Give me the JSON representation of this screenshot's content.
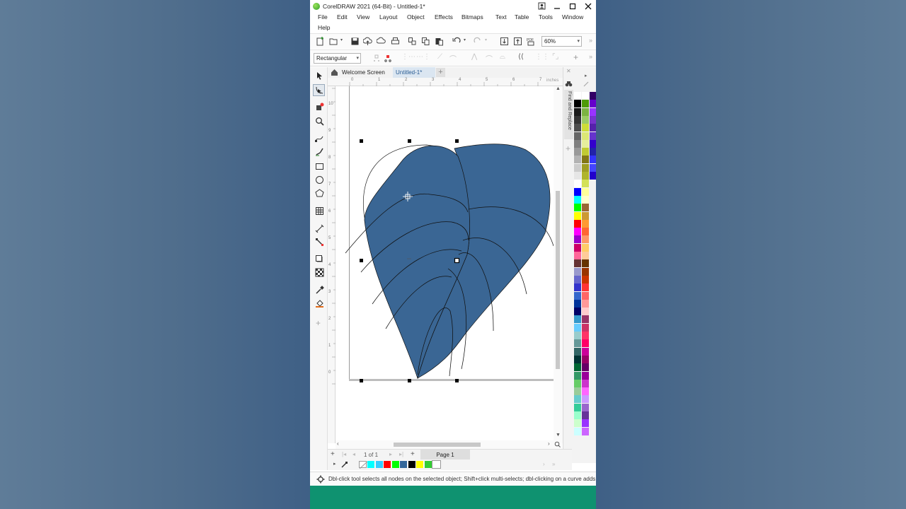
{
  "window": {
    "title": "CorelDRAW 2021 (64-Bit) - Untitled-1*",
    "menu": [
      "File",
      "Edit",
      "View",
      "Layout",
      "Object",
      "Effects",
      "Bitmaps",
      "Text",
      "Table",
      "Tools",
      "Window",
      "Help"
    ]
  },
  "toolbar": {
    "zoom_value": "60%"
  },
  "property_bar": {
    "mode_value": "Rectangular"
  },
  "tabs": {
    "welcome": "Welcome Screen",
    "doc": "Untitled-1*"
  },
  "ruler": {
    "unit": "inches",
    "h_ticks": [
      "0",
      "1",
      "2",
      "3",
      "4",
      "5",
      "6",
      "7"
    ],
    "v_ticks": [
      "10",
      "9",
      "8",
      "7",
      "6",
      "5",
      "4",
      "3",
      "2",
      "1",
      "0"
    ]
  },
  "docker": {
    "label": "Find and Replace"
  },
  "page_nav": {
    "counter": "1 of 1",
    "page_tab": "Page 1"
  },
  "status": {
    "text": "Dbl-click tool selects all nodes on the selected object; Shift+click multi-selects; dbl-clicking on a curve adds"
  },
  "colors": {
    "leaf_fill": "#3a6694",
    "accent_green": "#0f9270",
    "palette_col1": [
      "#ffffff",
      "#000000",
      "#1a1a1a",
      "#333333",
      "#4d4d4d",
      "#666666",
      "#808080",
      "#999999",
      "#b3b3b3",
      "#cccccc",
      "#e6e6e6",
      "#ffffff",
      "#0000ff",
      "#00ffff",
      "#00ff00",
      "#ffff00",
      "#ff0000",
      "#ff00ff",
      "#9900cc",
      "#cc0066",
      "#ff6699",
      "#663333",
      "#9999cc",
      "#6666cc",
      "#3333cc",
      "#3366cc",
      "#003399",
      "#000066",
      "#3399cc",
      "#66ccff",
      "#99cccc",
      "#669999",
      "#336666",
      "#003333",
      "#006633",
      "#339966",
      "#66cc66",
      "#99cc99",
      "#66cccc",
      "#33cc99",
      "#99ffcc",
      "#ccffcc",
      "#ccffff"
    ],
    "palette_col2": [
      "#ffffff",
      "#4e9a06",
      "#7cb342",
      "#9ccc65",
      "#cddc39",
      "#dce775",
      "#e6ee9c",
      "#c0ca33",
      "#827717",
      "#9e9d24",
      "#afb42b",
      "#d4e157",
      "#ffff99",
      "#ffffcc",
      "#996633",
      "#cc9933",
      "#ff9933",
      "#ff6633",
      "#ff9966",
      "#ffcc66",
      "#ffcc99",
      "#663300",
      "#993300",
      "#cc3300",
      "#ff3333",
      "#ff6666",
      "#ff9999",
      "#ffcccc",
      "#993366",
      "#cc3366",
      "#ff3366",
      "#ff0066",
      "#cc0099",
      "#990066",
      "#660066",
      "#990099",
      "#cc33cc",
      "#ff66ff",
      "#cc99ff",
      "#9966cc",
      "#663399",
      "#9933ff",
      "#cc66ff"
    ],
    "palette_col3": [
      "#330066",
      "#6600cc",
      "#9933ff",
      "#7733cc",
      "#5522aa",
      "#6633cc",
      "#3300cc",
      "#2222aa",
      "#3333ff",
      "#4444ff",
      "#2200cc"
    ],
    "doc_palette": [
      "#00ffff",
      "#33ccff",
      "#ff0000",
      "#00ff00",
      "#336699",
      "#000000",
      "#ffff00",
      "#33cc33",
      "#ffffff"
    ]
  }
}
